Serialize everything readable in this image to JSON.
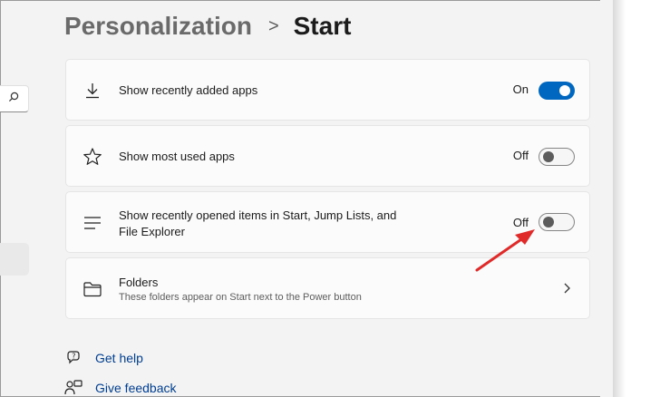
{
  "header": {
    "parent": "Personalization",
    "separator": ">",
    "current": "Start"
  },
  "nav": {
    "search_icon": "search-icon"
  },
  "settings": [
    {
      "icon": "download-icon",
      "label": "Show recently added apps",
      "state_text": "On",
      "toggle": "on"
    },
    {
      "icon": "star-icon",
      "label": "Show most used apps",
      "state_text": "Off",
      "toggle": "off"
    },
    {
      "icon": "list-lines-icon",
      "label_line1": "Show recently opened items in Start, Jump Lists, and",
      "label_line2": "File Explorer",
      "state_text": "Off",
      "toggle": "off"
    },
    {
      "icon": "folder-icon",
      "label": "Folders",
      "sublabel": "These folders appear on Start next to the Power button"
    }
  ],
  "links": {
    "help": "Get help",
    "feedback": "Give feedback"
  },
  "colors": {
    "accent": "#0067c0",
    "annotation_arrow": "#e02a2a",
    "link": "#003e92"
  }
}
